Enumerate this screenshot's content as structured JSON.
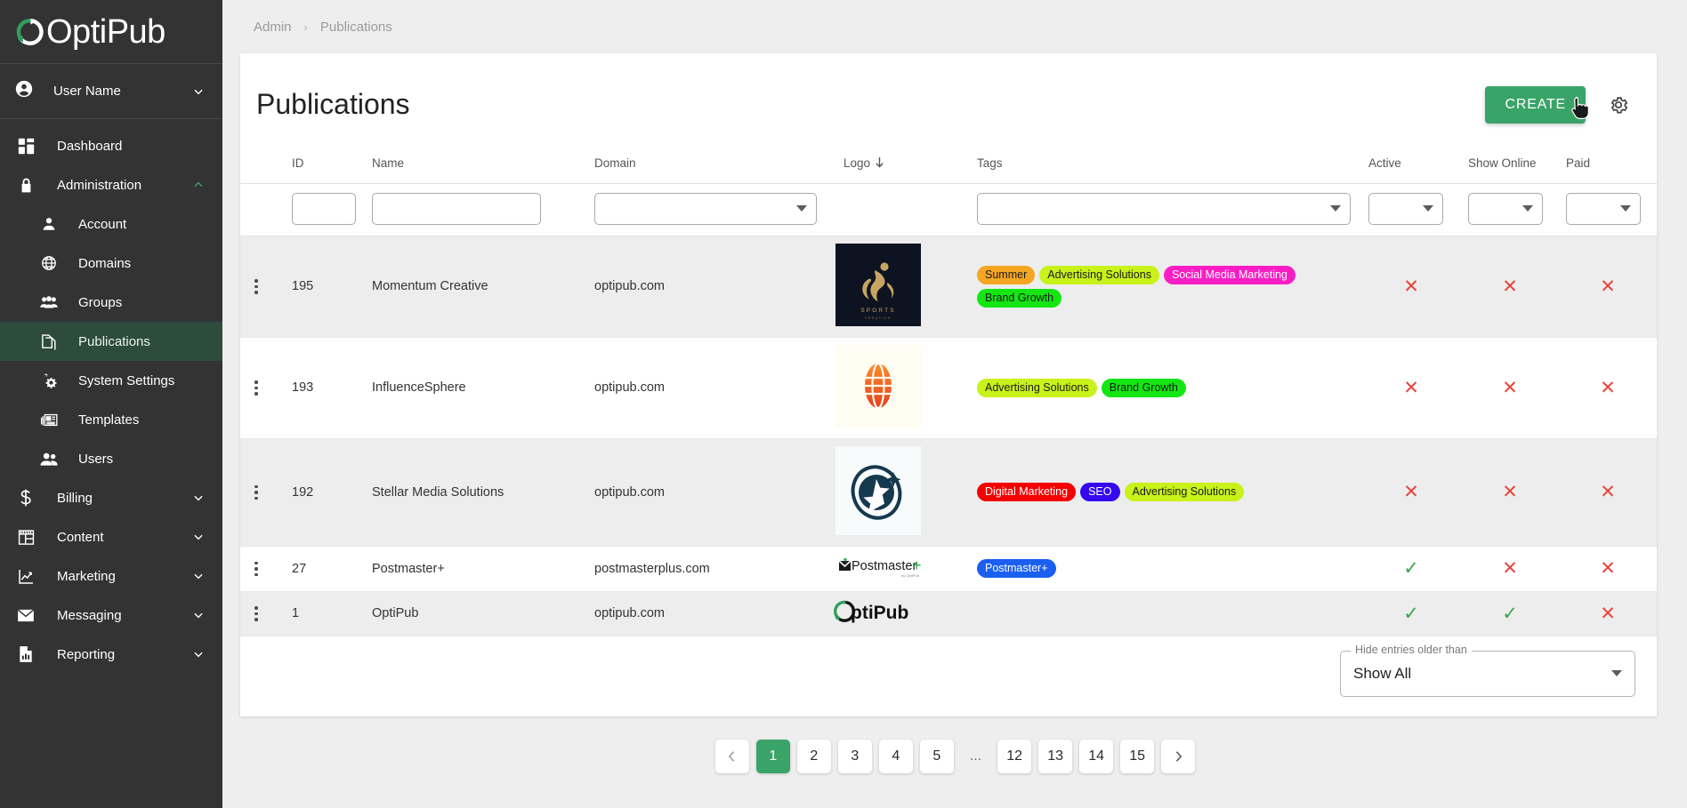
{
  "brand": {
    "name": "OptiPub",
    "logo_icon": "optipub-circular-arrow-logo",
    "accent": "#3aa468"
  },
  "sidebar": {
    "user": {
      "label": "User Name",
      "icon": "account-circle-icon",
      "chevron": "chevron-down-icon"
    },
    "items": [
      {
        "label": "Dashboard",
        "icon": "dashboard-grid-icon",
        "level": "top",
        "expandable": false,
        "active": false
      },
      {
        "label": "Administration",
        "icon": "lock-icon",
        "level": "top",
        "expandable": true,
        "expanded": true,
        "active": false
      },
      {
        "label": "Account",
        "icon": "person-icon",
        "level": "sub",
        "active": false
      },
      {
        "label": "Domains",
        "icon": "globe-icon",
        "level": "sub",
        "active": false
      },
      {
        "label": "Groups",
        "icon": "groups-icon",
        "level": "sub",
        "active": false
      },
      {
        "label": "Publications",
        "icon": "documents-icon",
        "level": "sub",
        "active": true
      },
      {
        "label": "System Settings",
        "icon": "gears-icon",
        "level": "sub",
        "active": false
      },
      {
        "label": "Templates",
        "icon": "template-icon",
        "level": "sub",
        "active": false
      },
      {
        "label": "Users",
        "icon": "users-icon",
        "level": "sub",
        "active": false
      },
      {
        "label": "Billing",
        "icon": "dollar-icon",
        "level": "top",
        "expandable": true,
        "expanded": false,
        "active": false
      },
      {
        "label": "Content",
        "icon": "content-layout-icon",
        "level": "top",
        "expandable": true,
        "expanded": false,
        "active": false
      },
      {
        "label": "Marketing",
        "icon": "chart-line-icon",
        "level": "top",
        "expandable": true,
        "expanded": false,
        "active": false
      },
      {
        "label": "Messaging",
        "icon": "envelope-icon",
        "level": "top",
        "expandable": true,
        "expanded": false,
        "active": false
      },
      {
        "label": "Reporting",
        "icon": "report-bar-icon",
        "level": "top",
        "expandable": true,
        "expanded": false,
        "active": false
      }
    ]
  },
  "breadcrumb": {
    "root": "Admin",
    "separator": "›",
    "current": "Publications"
  },
  "header": {
    "title": "Publications",
    "create_label": "CREATE",
    "settings_icon": "gear-icon"
  },
  "table": {
    "columns": [
      {
        "key": "menu",
        "label": ""
      },
      {
        "key": "id",
        "label": "ID"
      },
      {
        "key": "name",
        "label": "Name"
      },
      {
        "key": "domain",
        "label": "Domain"
      },
      {
        "key": "logo",
        "label": "Logo",
        "sorted": "desc",
        "sort_icon": "arrow-down-icon"
      },
      {
        "key": "tags",
        "label": "Tags"
      },
      {
        "key": "active",
        "label": "Active"
      },
      {
        "key": "show_online",
        "label": "Show Online"
      },
      {
        "key": "paid",
        "label": "Paid"
      }
    ],
    "filters": {
      "id_value": "",
      "name_value": "",
      "domain_value": "",
      "tags_value": "",
      "active_value": "",
      "show_online_value": "",
      "paid_value": ""
    },
    "rows": [
      {
        "id": "195",
        "name": "Momentum Creative",
        "domain": "optipub.com",
        "logo_alt": "sports-creative-logo",
        "tags": [
          {
            "label": "Summer",
            "bg": "#f5a623",
            "fg": "#1a1a1a"
          },
          {
            "label": "Advertising Solutions",
            "bg": "#c8f21a",
            "fg": "#1a1a1a"
          },
          {
            "label": "Social Media Marketing",
            "bg": "#f81ec4",
            "fg": "#ffffff"
          },
          {
            "label": "Brand Growth",
            "bg": "#14e614",
            "fg": "#1a1a1a"
          }
        ],
        "active": "false",
        "show_online": "false",
        "paid": "false"
      },
      {
        "id": "193",
        "name": "InfluenceSphere",
        "domain": "optipub.com",
        "logo_alt": "orange-globe-logo",
        "tags": [
          {
            "label": "Advertising Solutions",
            "bg": "#c8f21a",
            "fg": "#1a1a1a"
          },
          {
            "label": "Brand Growth",
            "bg": "#14e614",
            "fg": "#1a1a1a"
          }
        ],
        "active": "false",
        "show_online": "false",
        "paid": "false"
      },
      {
        "id": "192",
        "name": "Stellar Media Solutions",
        "domain": "optipub.com",
        "logo_alt": "stellar-star-logo",
        "tags": [
          {
            "label": "Digital Marketing",
            "bg": "#f40000",
            "fg": "#ffffff"
          },
          {
            "label": "SEO",
            "bg": "#3409f0",
            "fg": "#ffffff"
          },
          {
            "label": "Advertising Solutions",
            "bg": "#c8f21a",
            "fg": "#1a1a1a"
          }
        ],
        "active": "false",
        "show_online": "false",
        "paid": "false"
      },
      {
        "id": "27",
        "name": "Postmaster+",
        "domain": "postmasterplus.com",
        "logo_alt": "postmaster-plus-logo",
        "tags": [
          {
            "label": "Postmaster+",
            "bg": "#1a5ff0",
            "fg": "#ffffff"
          }
        ],
        "active": "true",
        "show_online": "false",
        "paid": "false"
      },
      {
        "id": "1",
        "name": "OptiPub",
        "domain": "optipub.com",
        "logo_alt": "optipub-logo",
        "tags": [],
        "active": "true",
        "show_online": "true",
        "paid": "false"
      }
    ],
    "marks": {
      "true": "✓",
      "false": "✕"
    }
  },
  "footer_filter": {
    "label": "Hide entries older than",
    "value": "Show All",
    "icon": "chevron-down-icon"
  },
  "pagination": {
    "prev_icon": "chevron-left-icon",
    "next_icon": "chevron-right-icon",
    "ellipsis": "...",
    "current": "1",
    "pages": [
      "1",
      "2",
      "3",
      "4",
      "5",
      "...",
      "12",
      "13",
      "14",
      "15"
    ]
  }
}
